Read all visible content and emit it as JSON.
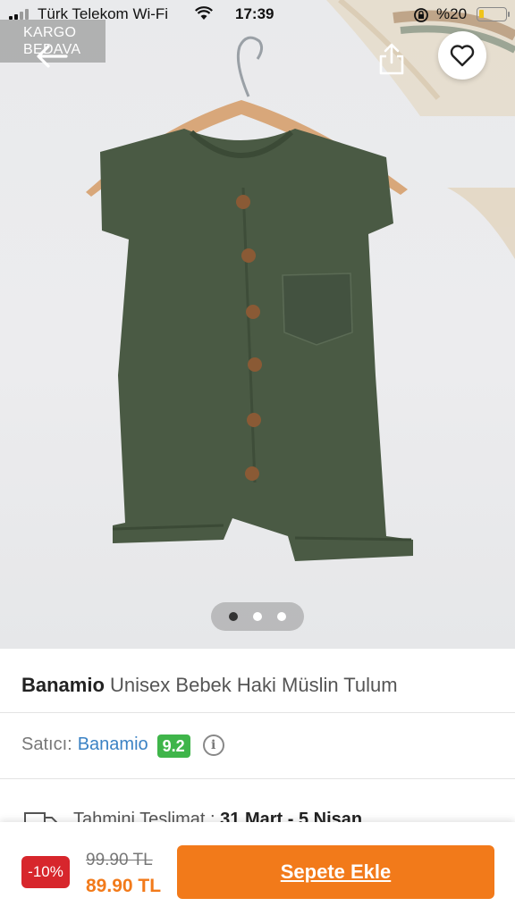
{
  "status_bar": {
    "carrier": "Türk Telekom Wi-Fi",
    "time": "17:39",
    "battery": "%20",
    "battery_level": 0.2
  },
  "badge": {
    "line1": "KARGO",
    "line2": "BEDAVA"
  },
  "icons": {
    "back": "arrow-left-icon",
    "share": "share-icon",
    "favorite": "heart-icon",
    "info": "info-icon",
    "delivery": "truck-icon"
  },
  "gallery": {
    "image_count": 3,
    "active_index": 0
  },
  "product": {
    "brand": "Banamio",
    "name": "Unisex Bebek Haki Müslin Tulum"
  },
  "seller": {
    "label": "Satıcı:",
    "name": "Banamio",
    "score": "9.2",
    "info_glyph": "i"
  },
  "delivery": {
    "label": "Tahmini Teslimat :",
    "dates": "31 Mart - 5 Nisan"
  },
  "purchase": {
    "discount": "-10%",
    "old_price": "99.90 TL",
    "new_price": "89.90 TL",
    "add_to_cart_label": "Sepete Ekle"
  },
  "colors": {
    "accent": "#f27a1a",
    "discount": "#d7262c",
    "score": "#3fb54a",
    "link": "#3b82c4",
    "garment": "#4a5a44"
  }
}
